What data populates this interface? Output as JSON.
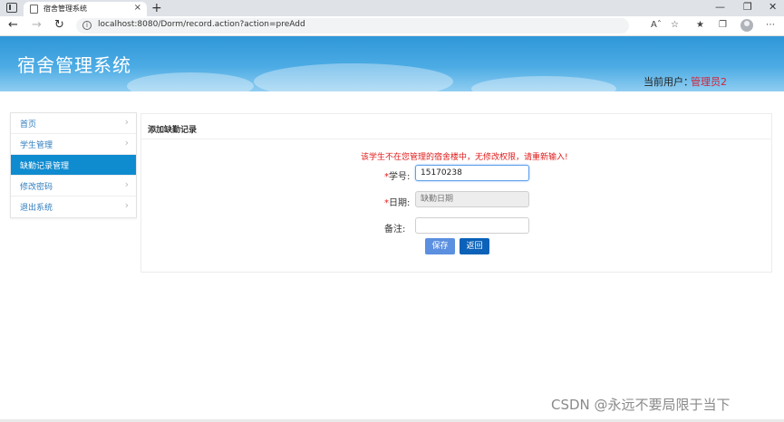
{
  "browser": {
    "tab_title": "宿舍管理系统",
    "tab_close": "×",
    "new_tab": "+",
    "url": "localhost:8080/Dorm/record.action?action=preAdd",
    "win_minimize": "—",
    "win_maximize": "❐",
    "win_close": "✕",
    "icons": [
      "back-arrow-icon",
      "forward-arrow-icon",
      "refresh-icon",
      "info-icon",
      "read-aloud-icon",
      "favorite-add-icon",
      "favorites-icon",
      "collections-icon",
      "profile-icon",
      "more-icon"
    ]
  },
  "header": {
    "title": "宿舍管理系统",
    "user_label": "当前用户：",
    "user_name": "管理员2"
  },
  "sidebar": {
    "items": [
      {
        "label": "首页",
        "active": false
      },
      {
        "label": "学生管理",
        "active": false
      },
      {
        "label": "缺勤记录管理",
        "active": true
      },
      {
        "label": "修改密码",
        "active": false
      },
      {
        "label": "退出系统",
        "active": false
      }
    ]
  },
  "panel": {
    "title": "添加缺勤记录",
    "error": "该学生不在您管理的宿舍楼中，无修改权限，请重新输入!",
    "fields": {
      "student_id": {
        "required": "*",
        "label": "学号:",
        "value": "15170238"
      },
      "date": {
        "required": "*",
        "label": "日期:",
        "placeholder": "缺勤日期"
      },
      "note": {
        "label": "备注:",
        "value": ""
      }
    },
    "buttons": {
      "save": "保存",
      "back": "返回"
    }
  },
  "watermark": "CSDN @永远不要局限于当下",
  "colors": {
    "header_blue": "#2f97d8",
    "sidebar_active": "#0f8bd0",
    "error_red": "#e01b1b",
    "user_red": "#d2233a",
    "save_button": "#5b8fe0",
    "back_button": "#0b62b8"
  }
}
